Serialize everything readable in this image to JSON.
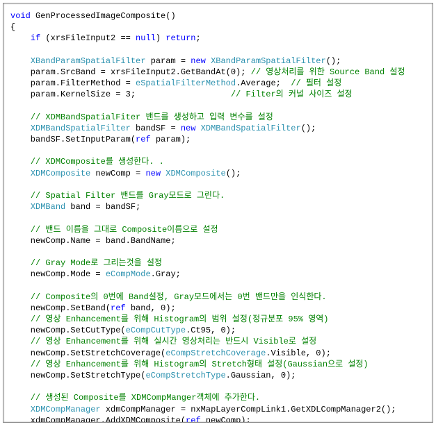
{
  "code": {
    "l1a": "void",
    "l1b": " GenProcessedImageComposite()",
    "l2": "{",
    "l3a": "    ",
    "l3b": "if",
    "l3c": " (xrsFileInput2 == ",
    "l3d": "null",
    "l3e": ") ",
    "l3f": "return",
    "l3g": ";",
    "l4": "",
    "l5a": "    ",
    "l5b": "XBandParamSpatialFilter",
    "l5c": " param = ",
    "l5d": "new",
    "l5e": " ",
    "l5f": "XBandParamSpatialFilter",
    "l5g": "();",
    "l6a": "    param.SrcBand = xrsFileInput2.GetBandAt(0); ",
    "l6b": "// 영상처리를 위한 Source Band 설정",
    "l7a": "    param.FilterMethod = ",
    "l7b": "eSpatialFilterMethod",
    "l7c": ".Average;  ",
    "l7d": "// 필터 설정",
    "l8a": "    param.KernelSize = 3;                   ",
    "l8b": "// Filter의 커널 사이즈 설정",
    "l9": "",
    "l10a": "    ",
    "l10b": "// XDMBandSpatialFiter 밴드를 생성하고 입력 변수를 설정",
    "l11a": "    ",
    "l11b": "XDMBandSpatialFilter",
    "l11c": " bandSF = ",
    "l11d": "new",
    "l11e": " ",
    "l11f": "XDMBandSpatialFilter",
    "l11g": "();",
    "l12a": "    bandSF.SetInputParam(",
    "l12b": "ref",
    "l12c": " param);",
    "l13": "",
    "l14a": "    ",
    "l14b": "// XDMComposite를 생성한다. .",
    "l15a": "    ",
    "l15b": "XDMComposite",
    "l15c": " newComp = ",
    "l15d": "new",
    "l15e": " ",
    "l15f": "XDMComposite",
    "l15g": "();",
    "l16": "",
    "l17a": "    ",
    "l17b": "// Spatial Filter 밴드를 Gray모드로 그린다.",
    "l18a": "    ",
    "l18b": "XDMBand",
    "l18c": " band = bandSF;",
    "l19": "",
    "l20a": "    ",
    "l20b": "// 밴드 이름을 그대로 Composite이름으로 설정",
    "l21": "    newComp.Name = band.BandName;",
    "l22": "",
    "l23a": "    ",
    "l23b": "// Gray Mode로 그리는것을 설정",
    "l24a": "    newComp.Mode = ",
    "l24b": "eCompMode",
    "l24c": ".Gray;",
    "l25": "",
    "l26a": "    ",
    "l26b": "// Composite의 0번에 Band설정, Gray모드에서는 0번 밴드만을 인식한다.",
    "l27a": "    newComp.SetBand(",
    "l27b": "ref",
    "l27c": " band, 0);",
    "l28a": "    ",
    "l28b": "// 영상 Enhancement를 위해 Histogram의 범위 설정(정규분포 95% 영역)",
    "l29a": "    newComp.SetCutType(",
    "l29b": "eCompCutType",
    "l29c": ".Ct95, 0);",
    "l30a": "    ",
    "l30b": "// 영상 Enhancement를 위해 실시간 영상처리는 반드시 Visible로 설정",
    "l31a": "    newComp.SetStretchCoverage(",
    "l31b": "eCompStretchCoverage",
    "l31c": ".Visible, 0);",
    "l32a": "    ",
    "l32b": "// 영상 Enhancement를 위해 Histogram의 Stretch형태 설정(Gaussian으로 설정)",
    "l33a": "    newComp.SetStretchType(",
    "l33b": "eCompStretchType",
    "l33c": ".Gaussian, 0);",
    "l34": "",
    "l35a": "    ",
    "l35b": "// 생성된 Composite를 XDMCompManger객체에 추가한다.",
    "l36a": "    ",
    "l36b": "XDMCompManager",
    "l36c": " xdmCompManager = nxMapLayerCompLink1.GetXDLCompManager2();",
    "l37a": "    xdmCompManager.AddXDMComposite(",
    "l37b": "ref",
    "l37c": " newComp);",
    "l38": "}"
  }
}
